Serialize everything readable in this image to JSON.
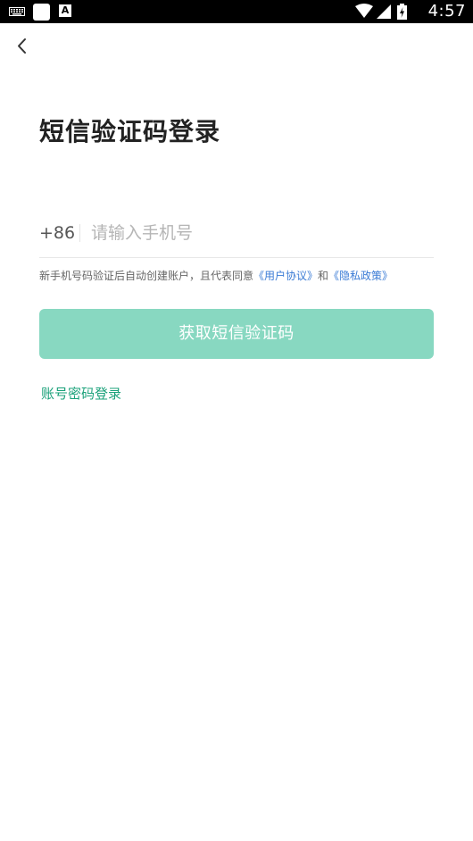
{
  "status_bar": {
    "time": "4:57",
    "notification_a_label": "A",
    "icons": [
      "keyboard-icon",
      "white-square-notification-icon",
      "a-notification-icon",
      "wifi-icon",
      "cell-signal-icon",
      "battery-charging-icon"
    ]
  },
  "header": {
    "back_icon": "chevron-left-icon"
  },
  "main": {
    "title": "短信验证码登录",
    "phone": {
      "country_code": "+86",
      "placeholder": "请输入手机号",
      "value": ""
    },
    "agreement": {
      "prefix": "新手机号码验证后自动创建账户，且代表同意",
      "user_agreement": "《用户协议》",
      "and": "和",
      "privacy_policy": "《隐私政策》"
    },
    "get_code_button": "获取短信验证码",
    "password_login_link": "账号密码登录"
  },
  "colors": {
    "primary_button_disabled": "#88d8c1",
    "link_green": "#1aa17a",
    "link_blue": "#3a7bd5",
    "title_text": "#222222"
  }
}
